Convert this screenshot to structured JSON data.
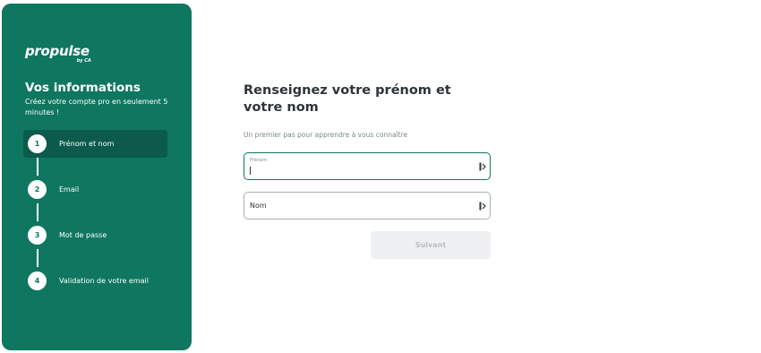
{
  "brand": {
    "logo": "propulse",
    "logo_sub": "by CA"
  },
  "sidebar": {
    "title": "Vos informations",
    "subtitle": "Créez votre compte pro en seulement 5 minutes !",
    "steps": [
      {
        "number": "1",
        "label": "Prénom et nom",
        "active": true
      },
      {
        "number": "2",
        "label": "Email",
        "active": false
      },
      {
        "number": "3",
        "label": "Mot de passe",
        "active": false
      },
      {
        "number": "4",
        "label": "Validation de votre email",
        "active": false
      }
    ]
  },
  "main": {
    "title": "Renseignez votre prénom et votre nom",
    "subtitle": "Un premier pas pour apprendre à vous connaître",
    "fields": {
      "first_name": {
        "label": "Prénom",
        "value": "",
        "icon": "autofill-icon"
      },
      "last_name": {
        "placeholder": "Nom",
        "value": "",
        "icon": "autofill-icon"
      }
    },
    "submit_label": "Suivant"
  },
  "colors": {
    "brand_green": "#0f7660",
    "active_step": "#0b5a4b",
    "disabled_button": "#eef0f2"
  }
}
